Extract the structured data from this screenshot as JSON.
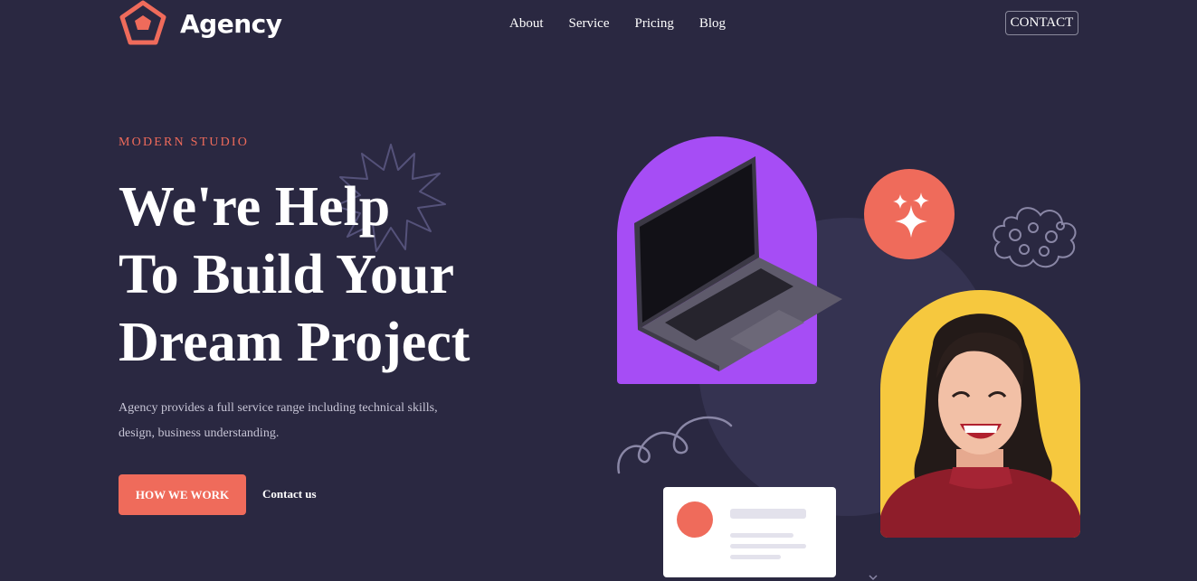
{
  "brand": {
    "name": "Agency",
    "logo_icon": "pentagon-logo-icon",
    "accent_color": "#ef6b5b"
  },
  "nav": {
    "items": [
      {
        "label": "About"
      },
      {
        "label": "Service"
      },
      {
        "label": "Pricing"
      },
      {
        "label": "Blog"
      }
    ],
    "contact_label": "CONTACT"
  },
  "hero": {
    "eyebrow": "MODERN STUDIO",
    "title_lines": [
      "We're Help",
      "To Build Your",
      "Dream Project"
    ],
    "description": "Agency provides a full service range including technical skills, design, business understanding.",
    "primary_button": "HOW WE WORK",
    "secondary_link": "Contact us"
  },
  "colors": {
    "background": "#2a2841",
    "purple_arch": "#a64df5",
    "yellow_arch": "#f6c83e",
    "accent": "#ef6b5b"
  },
  "icons": [
    "starburst-icon",
    "laptop-image",
    "sparkle-icon",
    "cloud-doodle-icon",
    "woman-portrait-image",
    "swirl-doodle-icon",
    "profile-card-placeholder"
  ]
}
